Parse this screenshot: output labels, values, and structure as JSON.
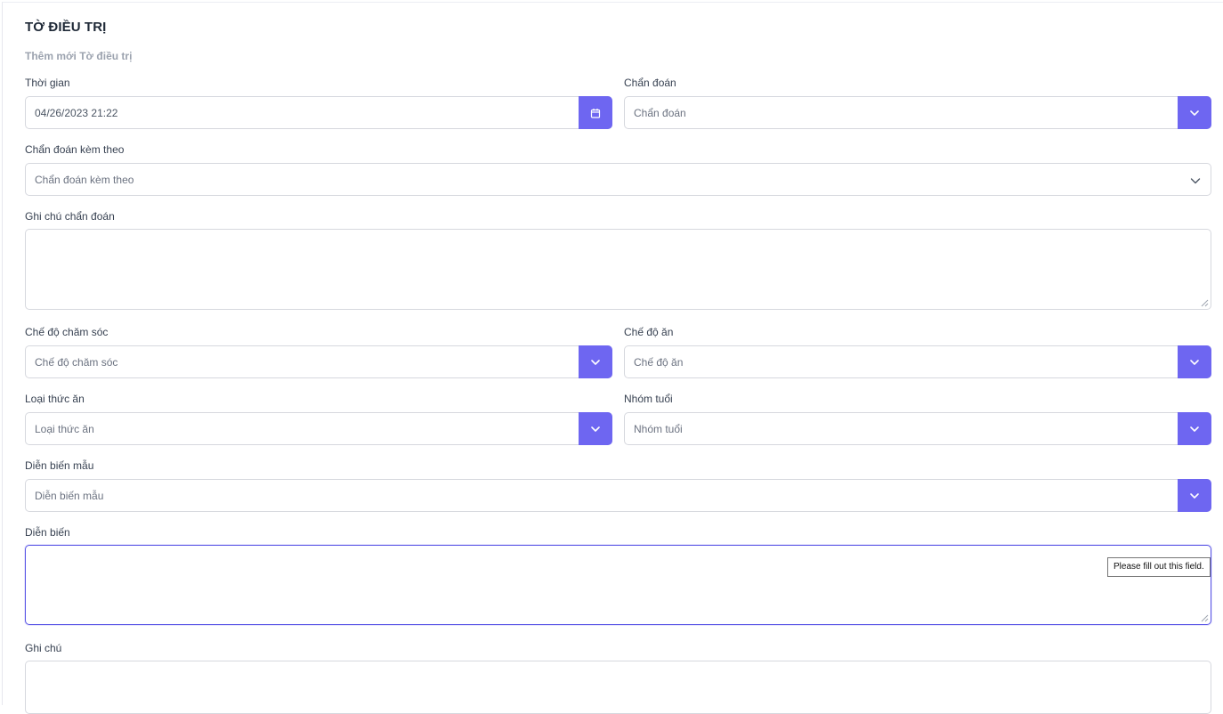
{
  "page": {
    "title": "TỜ ĐIỀU TRỊ",
    "subtitle": "Thêm mới Tờ điều trị"
  },
  "form": {
    "thoi_gian": {
      "label": "Thời gian",
      "value": "04/26/2023 21:22",
      "icon": "calendar-icon"
    },
    "chan_doan": {
      "label": "Chẩn đoán",
      "placeholder": "Chẩn đoán",
      "icon": "chevron-down-icon"
    },
    "chan_doan_kem_theo": {
      "label": "Chẩn đoán kèm theo",
      "placeholder": "Chẩn đoán kèm theo",
      "icon": "chevron-down-icon"
    },
    "ghi_chu_chan_doan": {
      "label": "Ghi chú chẩn đoán",
      "value": ""
    },
    "che_do_cham_soc": {
      "label": "Chế độ chăm sóc",
      "placeholder": "Chế độ chăm sóc",
      "icon": "chevron-down-icon"
    },
    "che_do_an": {
      "label": "Chế độ ăn",
      "placeholder": "Chế độ ăn",
      "icon": "chevron-down-icon"
    },
    "loai_thuc_an": {
      "label": "Loại thức ăn",
      "placeholder": "Loại thức ăn",
      "icon": "chevron-down-icon"
    },
    "nhom_tuoi": {
      "label": "Nhóm tuổi",
      "placeholder": "Nhóm tuổi",
      "icon": "chevron-down-icon"
    },
    "dien_bien_mau": {
      "label": "Diễn biến mẫu",
      "placeholder": "Diễn biến mẫu",
      "icon": "chevron-down-icon"
    },
    "dien_bien": {
      "label": "Diễn biến",
      "value": "",
      "validation_tooltip": "Please fill out this field."
    },
    "ghi_chu": {
      "label": "Ghi chú",
      "value": ""
    }
  },
  "colors": {
    "accent": "#6e66f1",
    "focus_border": "#5b57e6",
    "border": "#d6d8de"
  }
}
